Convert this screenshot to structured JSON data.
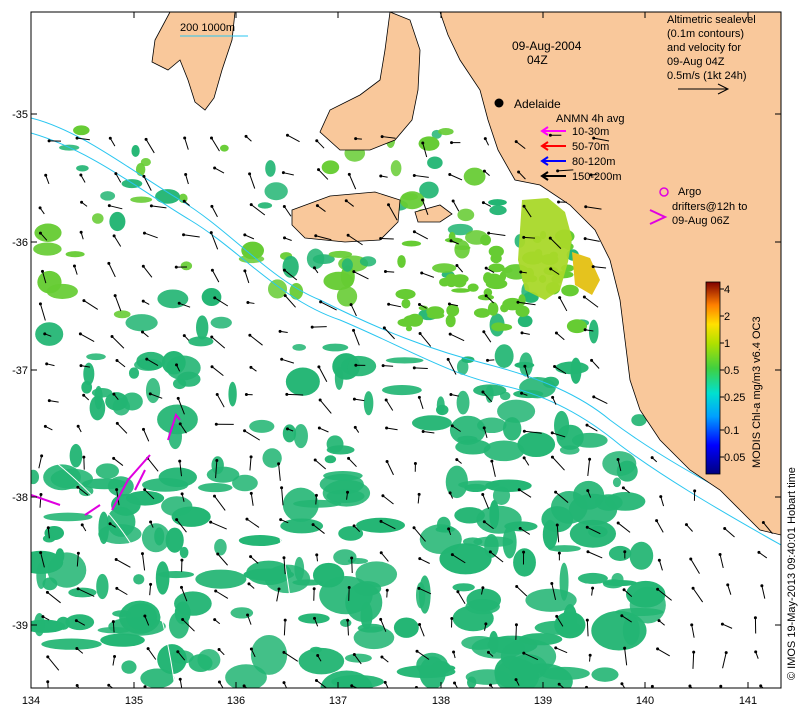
{
  "map": {
    "date": "09-Aug-2004",
    "time": "04Z",
    "city": "Adelaide",
    "scale_label": "200  1000m",
    "altimetry": {
      "line1": "Altimetric sealevel",
      "line2": "(0.1m contours)",
      "line3": "and velocity for",
      "line4": "09-Aug 04Z",
      "line5": "0.5m/s (1kt 24h)"
    },
    "anmn": {
      "title": "ANMN 4h avg",
      "depths": [
        {
          "label": "10-30m",
          "color": "#ff00ff"
        },
        {
          "label": "50-70m",
          "color": "#ff0000"
        },
        {
          "label": "80-120m",
          "color": "#0000ff"
        },
        {
          "label": "150-200m",
          "color": "#000000"
        }
      ]
    },
    "argo": {
      "line1": "Argo",
      "line2": "drifters@12h to",
      "line3": "09-Aug 06Z"
    },
    "colorbar": {
      "title": "MODIS Chl-a mg/m3 v6.4 OC3",
      "ticks": [
        "4",
        "2",
        "1",
        "0.5",
        "0.25",
        "0.1",
        "0.05"
      ]
    },
    "credit": "© IMOS 19-May-2013 09:40:01 Hobart time",
    "x_ticks": [
      "134",
      "135",
      "136",
      "137",
      "138",
      "139",
      "140",
      "141"
    ],
    "y_ticks": [
      "-35",
      "-36",
      "-37",
      "-38",
      "-39"
    ],
    "colors": {
      "land": "#f9c89b",
      "chl_low": "#22b573",
      "chl_mid": "#66cc33",
      "chl_high": "#c8e01e",
      "isobath": "#00c8ff",
      "arrow": "#000000"
    }
  }
}
